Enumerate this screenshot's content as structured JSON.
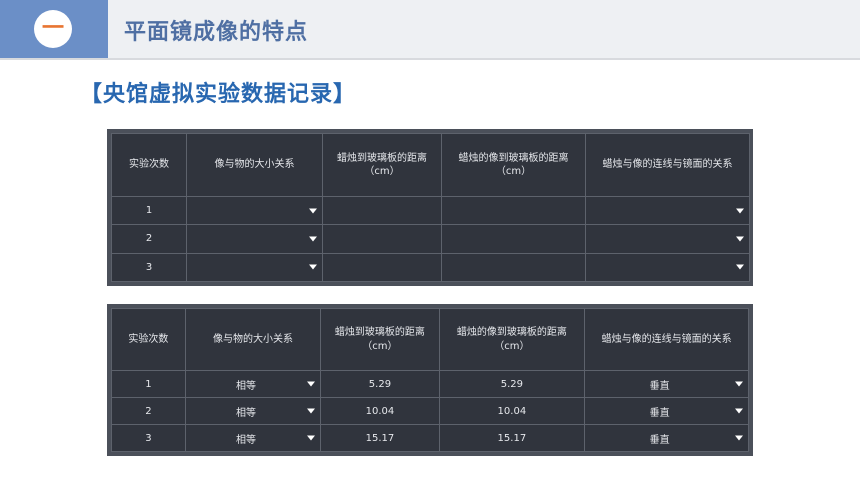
{
  "header": {
    "badge_glyph": "一",
    "title": "平面镜成像的特点"
  },
  "section_title": "【央馆虚拟实验数据记录】",
  "columns": [
    "实验次数",
    "像与物的大小关系",
    "蜡烛到玻璃板的距离（cm）",
    "蜡烛的像到玻璃板的距离（cm）",
    "蜡烛与像的连线与镜面的关系"
  ],
  "table_empty": {
    "rows": [
      {
        "trial": "1",
        "size_relation": "",
        "candle_distance": "",
        "image_distance": "",
        "line_relation": ""
      },
      {
        "trial": "2",
        "size_relation": "",
        "candle_distance": "",
        "image_distance": "",
        "line_relation": ""
      },
      {
        "trial": "3",
        "size_relation": "",
        "candle_distance": "",
        "image_distance": "",
        "line_relation": ""
      }
    ]
  },
  "table_filled": {
    "rows": [
      {
        "trial": "1",
        "size_relation": "相等",
        "candle_distance": "5.29",
        "image_distance": "5.29",
        "line_relation": "垂直"
      },
      {
        "trial": "2",
        "size_relation": "相等",
        "candle_distance": "10.04",
        "image_distance": "10.04",
        "line_relation": "垂直"
      },
      {
        "trial": "3",
        "size_relation": "相等",
        "candle_distance": "15.17",
        "image_distance": "15.17",
        "line_relation": "垂直"
      }
    ]
  },
  "colors": {
    "badge_bg": "#6b8fc7",
    "badge_glyph": "#e87532",
    "header_title": "#4f6fa3",
    "section_title": "#2867b0",
    "table_bg": "#30343d"
  },
  "icons": [
    "dropdown-arrow-icon"
  ]
}
